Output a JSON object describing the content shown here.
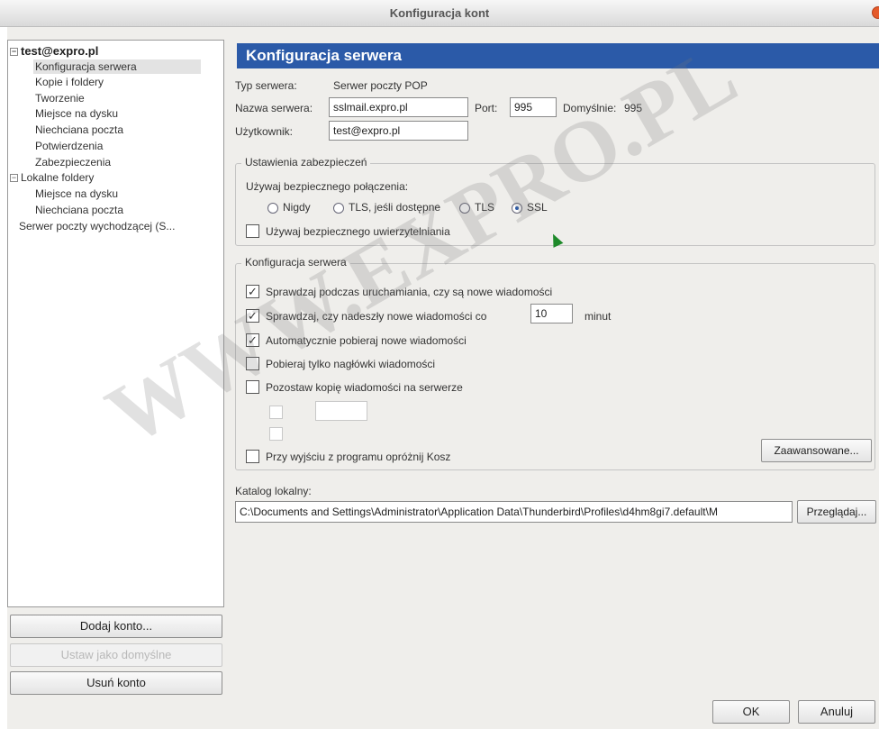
{
  "window": {
    "title": "Konfiguracja kont"
  },
  "tree": {
    "account": "test@expro.pl",
    "account_items": [
      "Konfiguracja serwera",
      "Kopie i foldery",
      "Tworzenie",
      "Miejsce na dysku",
      "Niechciana poczta",
      "Potwierdzenia",
      "Zabezpieczenia"
    ],
    "local": "Lokalne foldery",
    "local_items": [
      "Miejsce na dysku",
      "Niechciana poczta"
    ],
    "outgoing": "Serwer poczty wychodzącej (S..."
  },
  "buttons": {
    "add_account": "Dodaj konto...",
    "set_default": "Ustaw jako domyślne",
    "remove_account": "Usuń konto",
    "advanced": "Zaawansowane...",
    "browse": "Przeglądaj...",
    "ok": "OK",
    "cancel": "Anuluj"
  },
  "main": {
    "header": "Konfiguracja serwera",
    "server_type_label": "Typ serwera:",
    "server_type_value": "Serwer poczty POP",
    "server_name_label": "Nazwa serwera:",
    "server_name_value": "sslmail.expro.pl",
    "port_label": "Port:",
    "port_value": "995",
    "default_label": "Domyślnie:",
    "default_value": "995",
    "user_label": "Użytkownik:",
    "user_value": "test@expro.pl"
  },
  "security": {
    "group_title": "Ustawienia zabezpieczeń",
    "use_secure_label": "Używaj bezpiecznego połączenia:",
    "options": [
      "Nigdy",
      "TLS, jeśli dostępne",
      "TLS",
      "SSL"
    ],
    "selected": "SSL",
    "secure_auth_label": "Używaj bezpiecznego uwierzytelniania"
  },
  "server_config": {
    "group_title": "Konfiguracja serwera",
    "check_startup": "Sprawdzaj podczas uruchamiania, czy są nowe wiadomości",
    "check_every": "Sprawdzaj, czy nadeszły nowe wiadomości co",
    "check_every_value": "10",
    "minutes": "minut",
    "auto_download": "Automatycznie pobieraj nowe wiadomości",
    "headers_only": "Pobieraj tylko nagłówki wiadomości",
    "leave_copy": "Pozostaw kopię wiadomości na serwerze",
    "empty_trash": "Przy wyjściu z programu opróżnij Kosz"
  },
  "local_dir": {
    "label": "Katalog lokalny:",
    "value": "C:\\Documents and Settings\\Administrator\\Application Data\\Thunderbird\\Profiles\\d4hm8gi7.default\\M"
  },
  "watermark": "WWW.EXPRO.PL",
  "colors": {
    "header_bg": "#2b5aa8",
    "window_bg": "#efeeeb"
  }
}
